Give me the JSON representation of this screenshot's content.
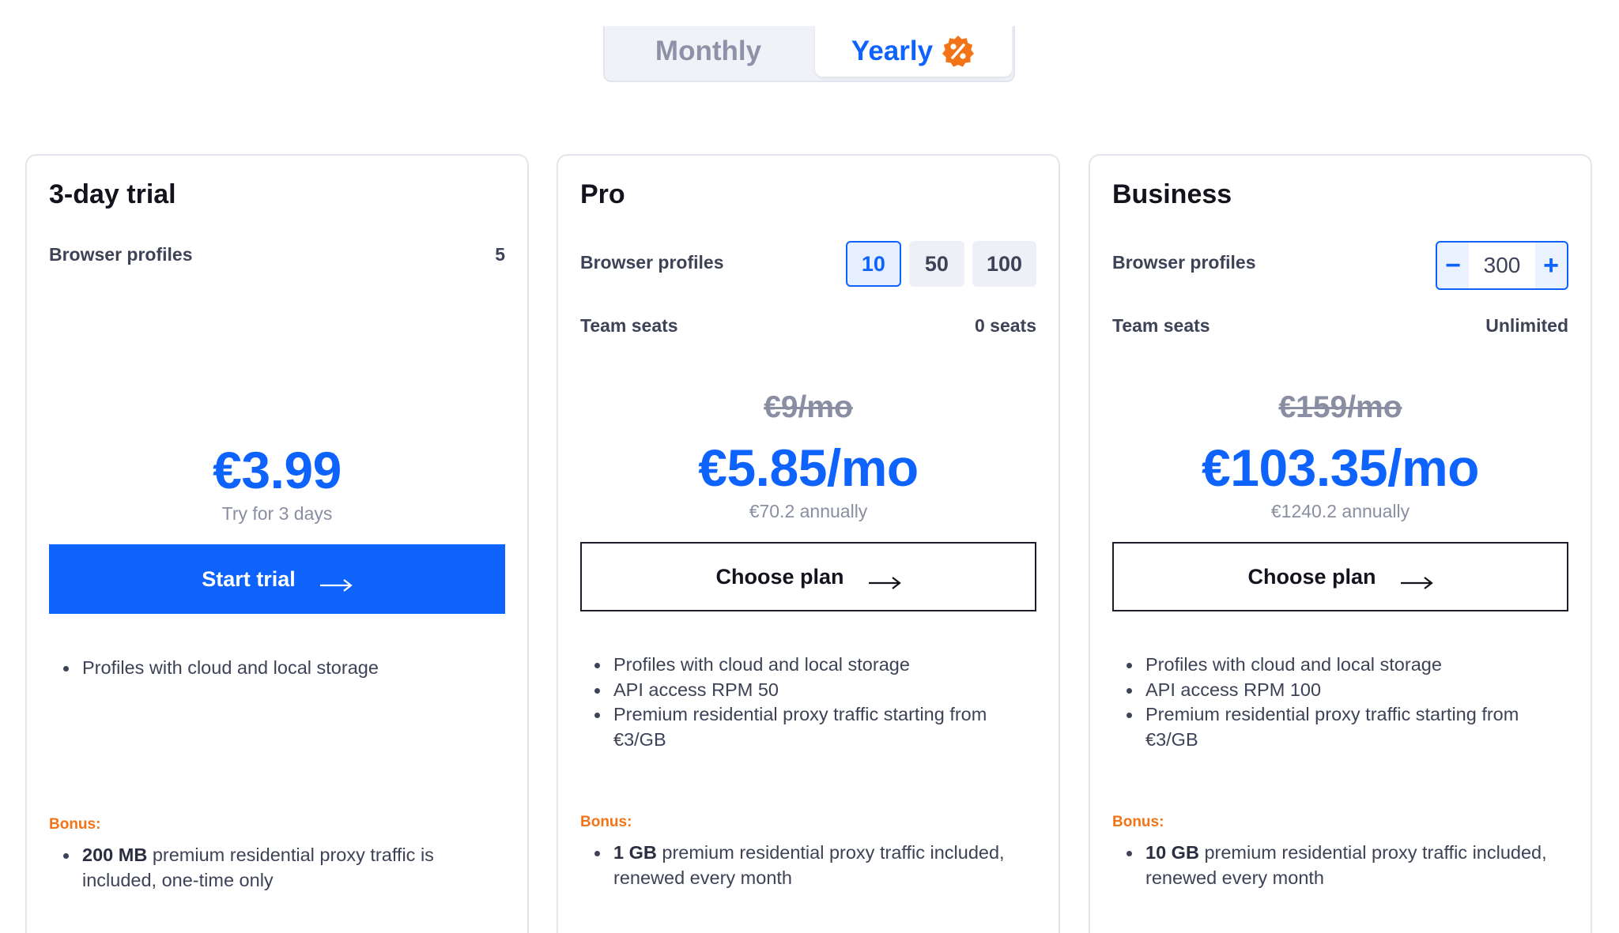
{
  "billing_toggle": {
    "monthly_label": "Monthly",
    "yearly_label": "Yearly",
    "selected": "Yearly"
  },
  "colors": {
    "accent": "#0d63fb",
    "bonus": "#f37416",
    "text": "#3e4257",
    "muted": "#8a8ea2"
  },
  "plans": [
    {
      "name": "3-day trial",
      "profiles_label": "Browser profiles",
      "profiles_value": "5",
      "price": "€3.99",
      "price_sub": "Try for 3 days",
      "cta": "Start trial",
      "features": [
        "Profiles with cloud and local storage"
      ],
      "bonus_label": "Bonus:",
      "bonus_strong": "200 MB",
      "bonus_text": " premium residential proxy traffic is included, one-time only"
    },
    {
      "name": "Pro",
      "profiles_label": "Browser profiles",
      "profile_options": [
        "10",
        "50",
        "100"
      ],
      "selected_profiles": "10",
      "team_label": "Team seats",
      "team_value": "0 seats",
      "old_price": "€9/mo",
      "price": "€5.85/mo",
      "price_sub": "€70.2 annually",
      "cta": "Choose plan",
      "features": [
        "Profiles with cloud and local storage",
        "API access RPM 50",
        "Premium residential proxy traffic starting from €3/GB"
      ],
      "bonus_label": "Bonus:",
      "bonus_strong": "1 GB",
      "bonus_text": " premium residential proxy traffic included, renewed every month"
    },
    {
      "name": "Business",
      "profiles_label": "Browser profiles",
      "stepper_value": "300",
      "stepper_minus": "−",
      "stepper_plus": "+",
      "team_label": "Team seats",
      "team_value": "Unlimited",
      "old_price": "€159/mo",
      "price": "€103.35/mo",
      "price_sub": "€1240.2 annually",
      "cta": "Choose plan",
      "features": [
        "Profiles with cloud and local storage",
        "API access RPM 100",
        "Premium residential proxy traffic starting from €3/GB"
      ],
      "bonus_label": "Bonus:",
      "bonus_strong": "10 GB",
      "bonus_text": " premium residential proxy traffic included, renewed every month"
    }
  ]
}
